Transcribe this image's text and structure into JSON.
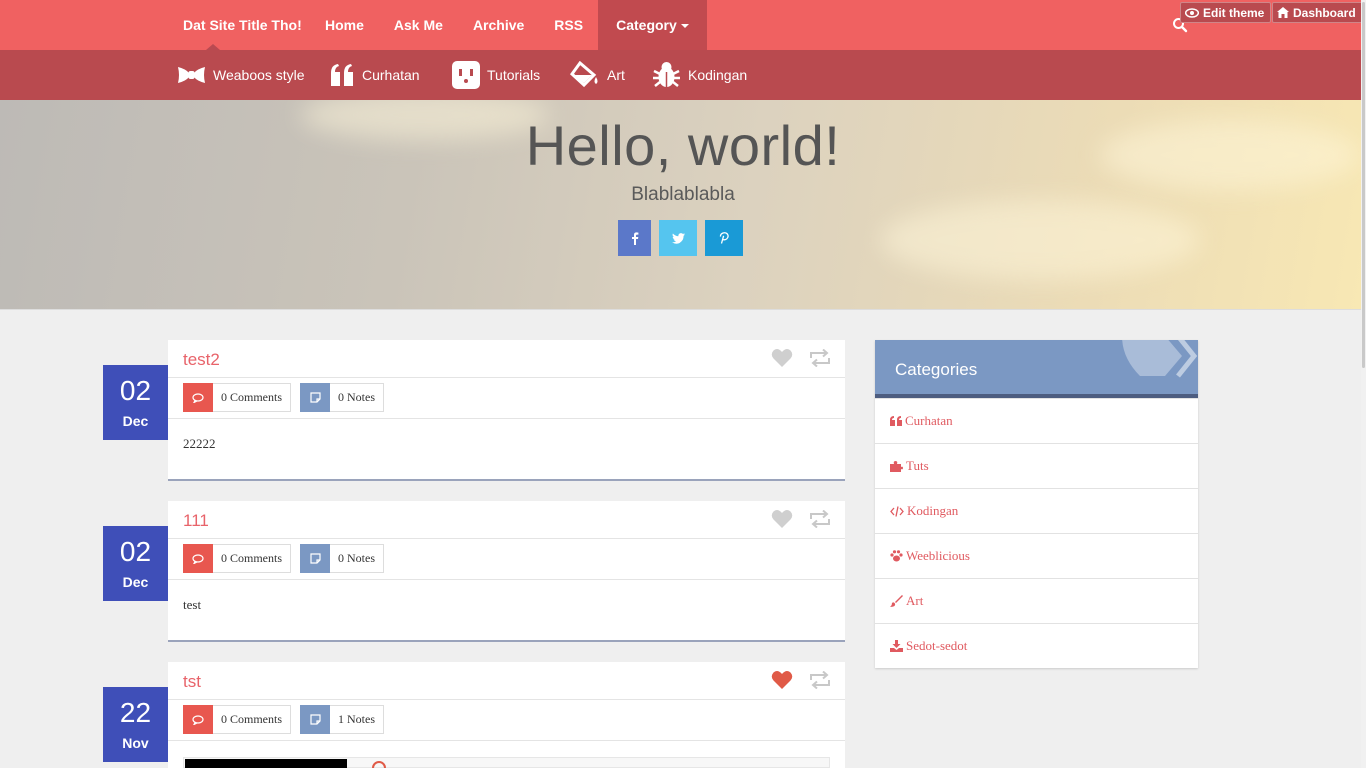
{
  "topnav": {
    "brand": "Dat Site Title Tho!",
    "links": [
      "Home",
      "Ask Me",
      "Archive",
      "RSS"
    ],
    "category_label": "Category",
    "edit_theme": "Edit theme",
    "dashboard": "Dashboard"
  },
  "subnav": {
    "items": [
      {
        "label": "Weaboos style",
        "icon": "bow-tie-icon"
      },
      {
        "label": "Curhatan",
        "icon": "quote-icon"
      },
      {
        "label": "Tutorials",
        "icon": "plug-icon"
      },
      {
        "label": "Art",
        "icon": "paint-bucket-icon"
      },
      {
        "label": "Kodingan",
        "icon": "bug-icon"
      }
    ]
  },
  "hero": {
    "title": "Hello, world!",
    "subtitle": "Blablablabla",
    "social": [
      "facebook-icon",
      "twitter-icon",
      "pinterest-icon"
    ]
  },
  "posts": [
    {
      "day": "02",
      "month": "Dec",
      "title": "test2",
      "comments": "0 Comments",
      "notes": "0 Notes",
      "body": "22222",
      "liked": false
    },
    {
      "day": "02",
      "month": "Dec",
      "title": "111",
      "comments": "0 Comments",
      "notes": "0 Notes",
      "body": "test",
      "liked": false
    },
    {
      "day": "22",
      "month": "Nov",
      "title": "tst",
      "comments": "0 Comments",
      "notes": "1 Notes",
      "body": "",
      "liked": true
    }
  ],
  "sidebar": {
    "title": "Categories",
    "items": [
      {
        "label": "Curhatan",
        "icon": "quote-icon"
      },
      {
        "label": "Tuts",
        "icon": "puzzle-icon"
      },
      {
        "label": "Kodingan",
        "icon": "code-icon"
      },
      {
        "label": "Weeblicious",
        "icon": "paw-icon"
      },
      {
        "label": "Art",
        "icon": "brush-icon"
      },
      {
        "label": "Sedot-sedot",
        "icon": "download-icon"
      }
    ]
  },
  "colors": {
    "nav": "#f06161",
    "subnav": "#b94a4f",
    "date_box": "#3f4fb8",
    "accent": "#e8636a",
    "comment_btn": "#e8574f",
    "notes_btn": "#7b98c3",
    "liked": "#e05a47",
    "facebook": "#5b78c9",
    "twitter": "#55c5ef",
    "pinterest": "#1a9ad6"
  }
}
